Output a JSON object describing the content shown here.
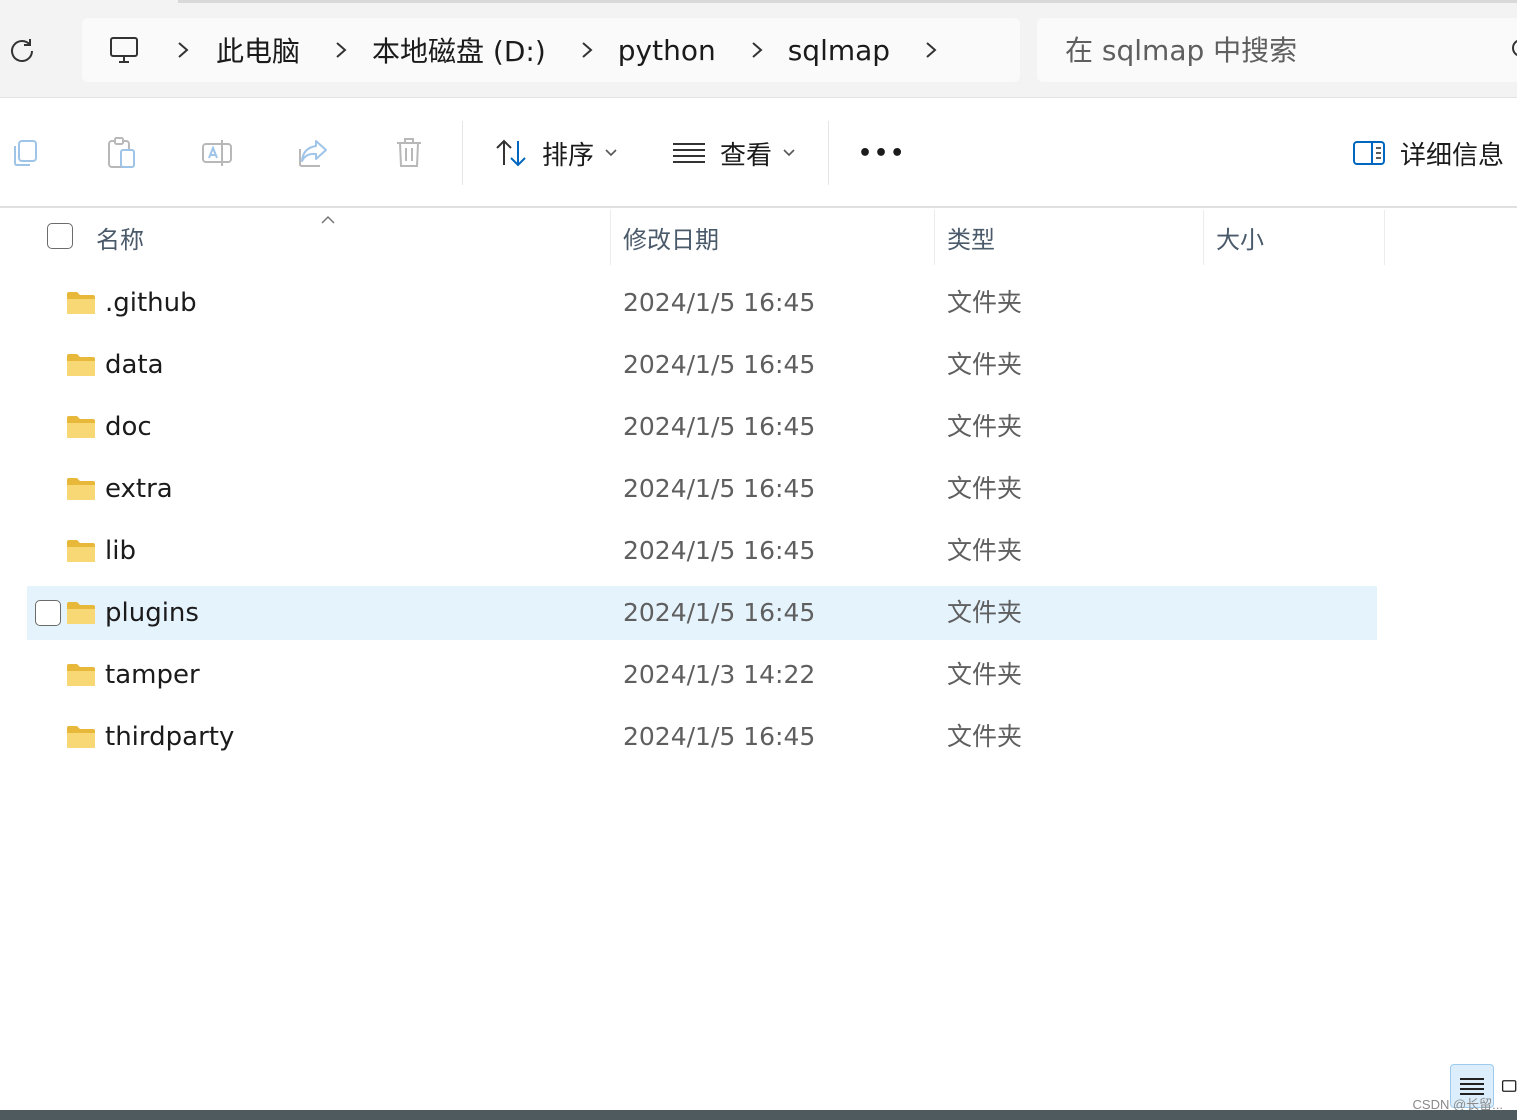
{
  "breadcrumb": {
    "items": [
      "此电脑",
      "本地磁盘 (D:)",
      "python",
      "sqlmap"
    ]
  },
  "search": {
    "placeholder": "在 sqlmap 中搜索"
  },
  "toolbar": {
    "sort_label": "排序",
    "view_label": "查看",
    "more_label": "•••",
    "details_label": "详细信息"
  },
  "columns": {
    "name": "名称",
    "date": "修改日期",
    "type": "类型",
    "size": "大小"
  },
  "files": [
    {
      "name": ".github",
      "modified": "2024/1/5 16:45",
      "type": "文件夹",
      "size": "",
      "selected": false
    },
    {
      "name": "data",
      "modified": "2024/1/5 16:45",
      "type": "文件夹",
      "size": "",
      "selected": false
    },
    {
      "name": "doc",
      "modified": "2024/1/5 16:45",
      "type": "文件夹",
      "size": "",
      "selected": false
    },
    {
      "name": "extra",
      "modified": "2024/1/5 16:45",
      "type": "文件夹",
      "size": "",
      "selected": false
    },
    {
      "name": "lib",
      "modified": "2024/1/5 16:45",
      "type": "文件夹",
      "size": "",
      "selected": false
    },
    {
      "name": "plugins",
      "modified": "2024/1/5 16:45",
      "type": "文件夹",
      "size": "",
      "selected": true
    },
    {
      "name": "tamper",
      "modified": "2024/1/3 14:22",
      "type": "文件夹",
      "size": "",
      "selected": false
    },
    {
      "name": "thirdparty",
      "modified": "2024/1/5 16:45",
      "type": "文件夹",
      "size": "",
      "selected": false
    }
  ],
  "watermark": "CSDN @长留...",
  "icons": {
    "refresh": "refresh-icon",
    "pc": "computer-icon",
    "separator": "chevron-right-icon",
    "copy": "copy-icon",
    "paste": "paste-icon",
    "rename": "rename-icon",
    "share": "share-icon",
    "delete": "delete-icon",
    "sort": "sort-icon",
    "view": "view-icon",
    "details": "details-pane-icon",
    "folder": "folder-icon"
  },
  "colors": {
    "folder": "#f8d775",
    "selected_row": "#e5f3fd",
    "accent": "#0067c0"
  }
}
